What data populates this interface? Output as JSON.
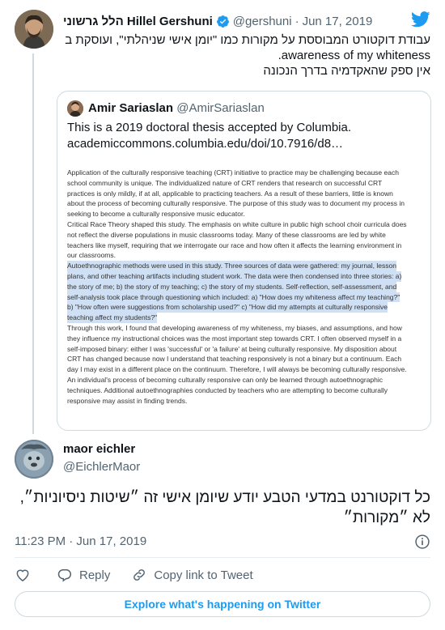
{
  "parent_tweet": {
    "author_name": "הלל גרשוני Hillel Gershuni",
    "handle": "@gershuni",
    "separator": "·",
    "date": "Jun 17, 2019",
    "text_lines": [
      "עבודת דוקטורט המבוססת על מקורות כמו \"יומן אישי שניהלתי\", ועוסקת ב",
      "awareness of my whiteness.",
      "אין ספק שהאקדמיה בדרך הנכונה"
    ]
  },
  "quoted_tweet": {
    "author_name": "Amir Sariaslan",
    "handle": "@AmirSariaslan",
    "text_lines": [
      "This is a 2019 doctoral thesis accepted by Columbia.",
      "academiccommons.columbia.edu/doi/10.7916/d8…"
    ],
    "document_lines": [
      {
        "t": "Application of the culturally responsive teaching (CRT) initiative to practice may be challenging because each",
        "hl": false
      },
      {
        "t": "school community is unique. The individualized nature of CRT renders that research on successful CRT",
        "hl": false
      },
      {
        "t": "practices is only mildly, if at all, applicable to practicing teachers. As a result of these barriers, little is known",
        "hl": false
      },
      {
        "t": "about the process of becoming culturally responsive. The purpose of this study was to document my process in",
        "hl": false
      },
      {
        "t": "seeking to become a culturally responsive music educator.",
        "hl": false
      },
      {
        "t": "Critical Race Theory shaped this study. The emphasis on white culture in public high school choir curricula does",
        "hl": false
      },
      {
        "t": "not reflect the diverse populations in music classrooms today. Many of these classrooms are led by white",
        "hl": false
      },
      {
        "t": "teachers like myself, requiring that we interrogate our race and how often it affects the learning environment in",
        "hl": false
      },
      {
        "t": "our classrooms.",
        "hl": false
      },
      {
        "t": "Autoethnographic methods were used in this study. Three sources of data were gathered: my journal, lesson",
        "hl": true
      },
      {
        "t": "plans, and other teaching artifacts including student work. The data were then condensed into three stories: a)",
        "hl": true
      },
      {
        "t": "the story of me; b) the story of my teaching; c) the story of my students. Self-reflection, self-assessment, and",
        "hl": true
      },
      {
        "t": "self-analysis took place through questioning which included: a) \"How does my whiteness affect my teaching?\"",
        "hl": true
      },
      {
        "t": "b) \"How often were suggestions from scholarship used?\" c) \"How did my attempts at culturally responsive",
        "hl": true
      },
      {
        "t": "teaching affect my students?\"",
        "hl": true
      },
      {
        "t": "Through this work, I found that developing awareness of my whiteness, my biases, and assumptions, and how",
        "hl": false
      },
      {
        "t": "they influence my instructional choices was the most important step towards CRT. I often observed myself in a",
        "hl": false
      },
      {
        "t": "self-imposed binary: either I was 'successful' or 'a failure' at being culturally responsive. My disposition about",
        "hl": false
      },
      {
        "t": "CRT has changed because now I understand that teaching responsively is not a binary but a continuum. Each",
        "hl": false
      },
      {
        "t": "day I may exist in a different place on the continuum. Therefore, I will always be becoming culturally responsive.",
        "hl": false
      },
      {
        "t": "An individual's process of becoming culturally responsive can only be learned through autoethnographic",
        "hl": false
      },
      {
        "t": "techniques. Additional autoethnographies conducted by teachers who are attempting to become culturally",
        "hl": false
      },
      {
        "t": "responsive may assist in finding trends.",
        "hl": false
      }
    ]
  },
  "reply_tweet": {
    "author_name": "maor eichler",
    "handle": "@EichlerMaor",
    "text_lines": [
      "כל דוקטורנט במדעי הטבע יודע שיומן אישי זה ״שיטות ניסיוניות״,",
      "לא ״מקורות״"
    ],
    "timestamp": "11:23 PM · Jun 17, 2019"
  },
  "actions": {
    "reply_label": "Reply",
    "copy_link_label": "Copy link to Tweet"
  },
  "footer": {
    "explore_label": "Explore what's happening on Twitter"
  },
  "colors": {
    "twitter_blue": "#1d9bf0",
    "secondary_text": "#536471",
    "highlight": "#cfe0f5",
    "border": "#cfd9de"
  }
}
